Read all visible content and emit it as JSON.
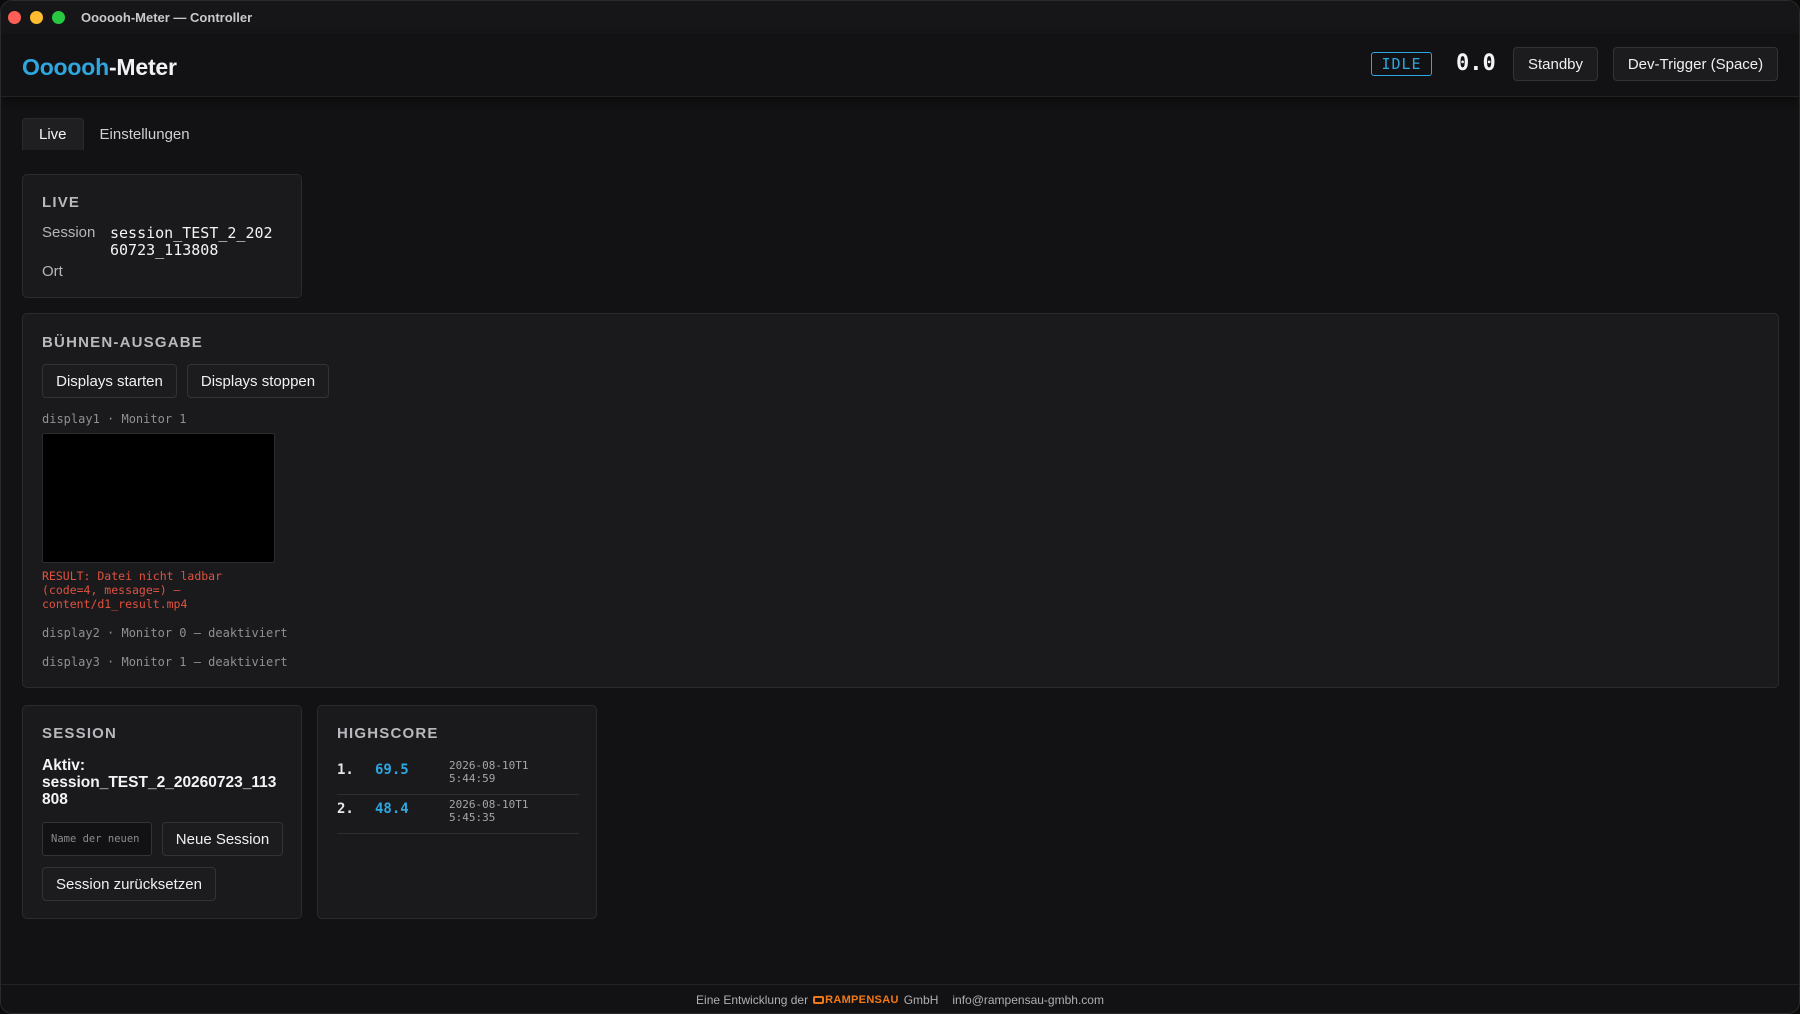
{
  "window": {
    "title": "Oooooh-Meter — Controller"
  },
  "header": {
    "brand_accent": "Oooooh",
    "brand_rest": "-Meter",
    "state": "IDLE",
    "meter_value": "0.0",
    "standby_label": "Standby",
    "dev_trigger_label": "Dev-Trigger (Space)"
  },
  "tabs": [
    {
      "label": "Live",
      "active": true
    },
    {
      "label": "Einstellungen",
      "active": false
    }
  ],
  "live": {
    "title": "LIVE",
    "session_key": "Session",
    "session_value": "session_TEST_2_20260723_113808",
    "location_key": "Ort",
    "location_value": ""
  },
  "stage": {
    "title": "BÜHNEN-AUSGABE",
    "start_label": "Displays starten",
    "stop_label": "Displays stoppen",
    "display1_label": "display1 · Monitor 1",
    "display1_error": "RESULT: Datei nicht ladbar (code=4, message=) — content/d1_result.mp4",
    "display2_label": "display2 · Monitor 0 — deaktiviert",
    "display3_label": "display3 · Monitor 1 — deaktiviert"
  },
  "session": {
    "title": "SESSION",
    "active_prefix": "Aktiv:",
    "active_value": "session_TEST_2_20260723_113808",
    "name_placeholder": "Name der neuen",
    "new_session_label": "Neue Session",
    "reset_label": "Session zurücksetzen"
  },
  "highscore": {
    "title": "HIGHSCORE",
    "entries": [
      {
        "rank": "1.",
        "score": "69.5",
        "time": "2026-08-10T15:44:59"
      },
      {
        "rank": "2.",
        "score": "48.4",
        "time": "2026-08-10T15:45:35"
      }
    ]
  },
  "footer": {
    "prefix": "Eine Entwicklung der",
    "company_logo": "RAMPENSAU",
    "company_suffix": "GmbH",
    "email": "info@rampensau-gmbh.com"
  },
  "colors": {
    "accent": "#2ea6df",
    "error": "#e0523f",
    "logo": "#f07a1a"
  }
}
